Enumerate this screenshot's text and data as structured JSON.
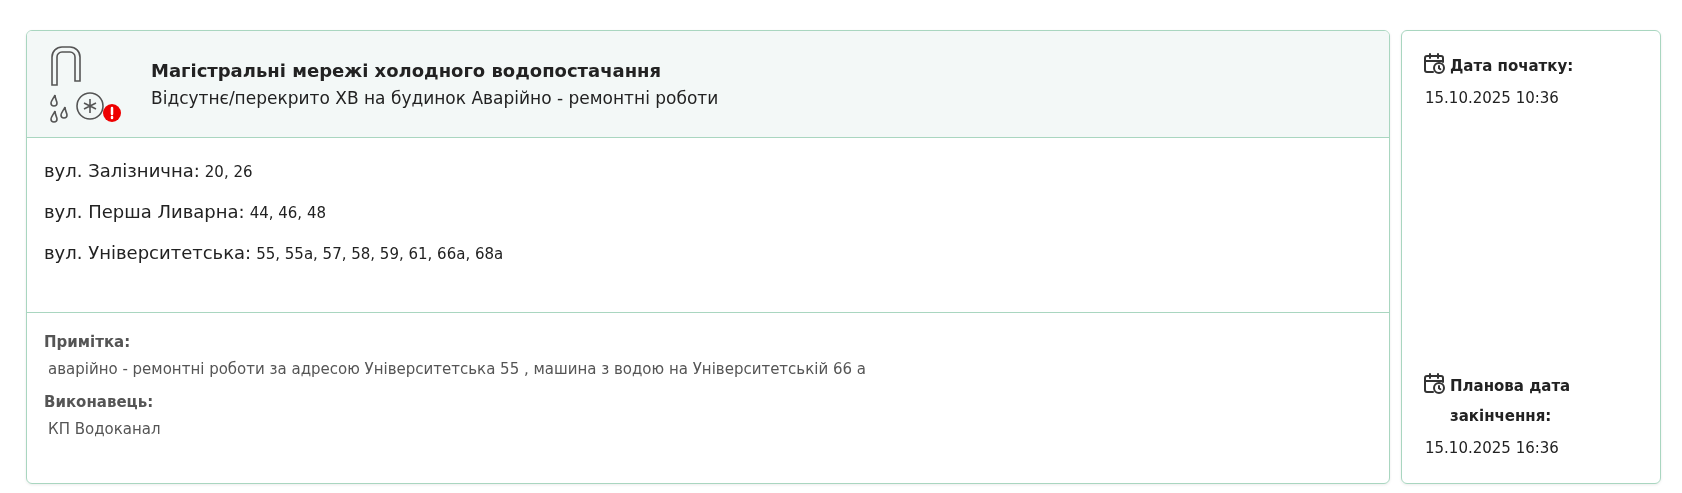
{
  "header": {
    "title": "Магістральні мережі холодного водопостачання",
    "subtitle": "Відсутнє/перекрито ХВ на будинок Аварійно - ремонтні роботи"
  },
  "streets": [
    {
      "name": "вул. Залізнична:",
      "houses": "20, 26"
    },
    {
      "name": "вул. Перша Ливарна:",
      "houses": "44, 46, 48"
    },
    {
      "name": "вул. Університетська:",
      "houses": "55, 55а, 57, 58, 59, 61, 66а, 68а"
    }
  ],
  "details": [
    {
      "label": "Примітка:",
      "value": "аварійно - ремонтні роботи за адресою Університетська 55 , машина з водою на Університетській 66 а"
    },
    {
      "label": "Виконавець:",
      "value": "КП Водоканал"
    }
  ],
  "dates": [
    {
      "label": "Дата початку:",
      "value": "15.10.2025 10:36"
    },
    {
      "label": "Планова дата закінчення:",
      "value": "15.10.2025 16:36"
    }
  ]
}
